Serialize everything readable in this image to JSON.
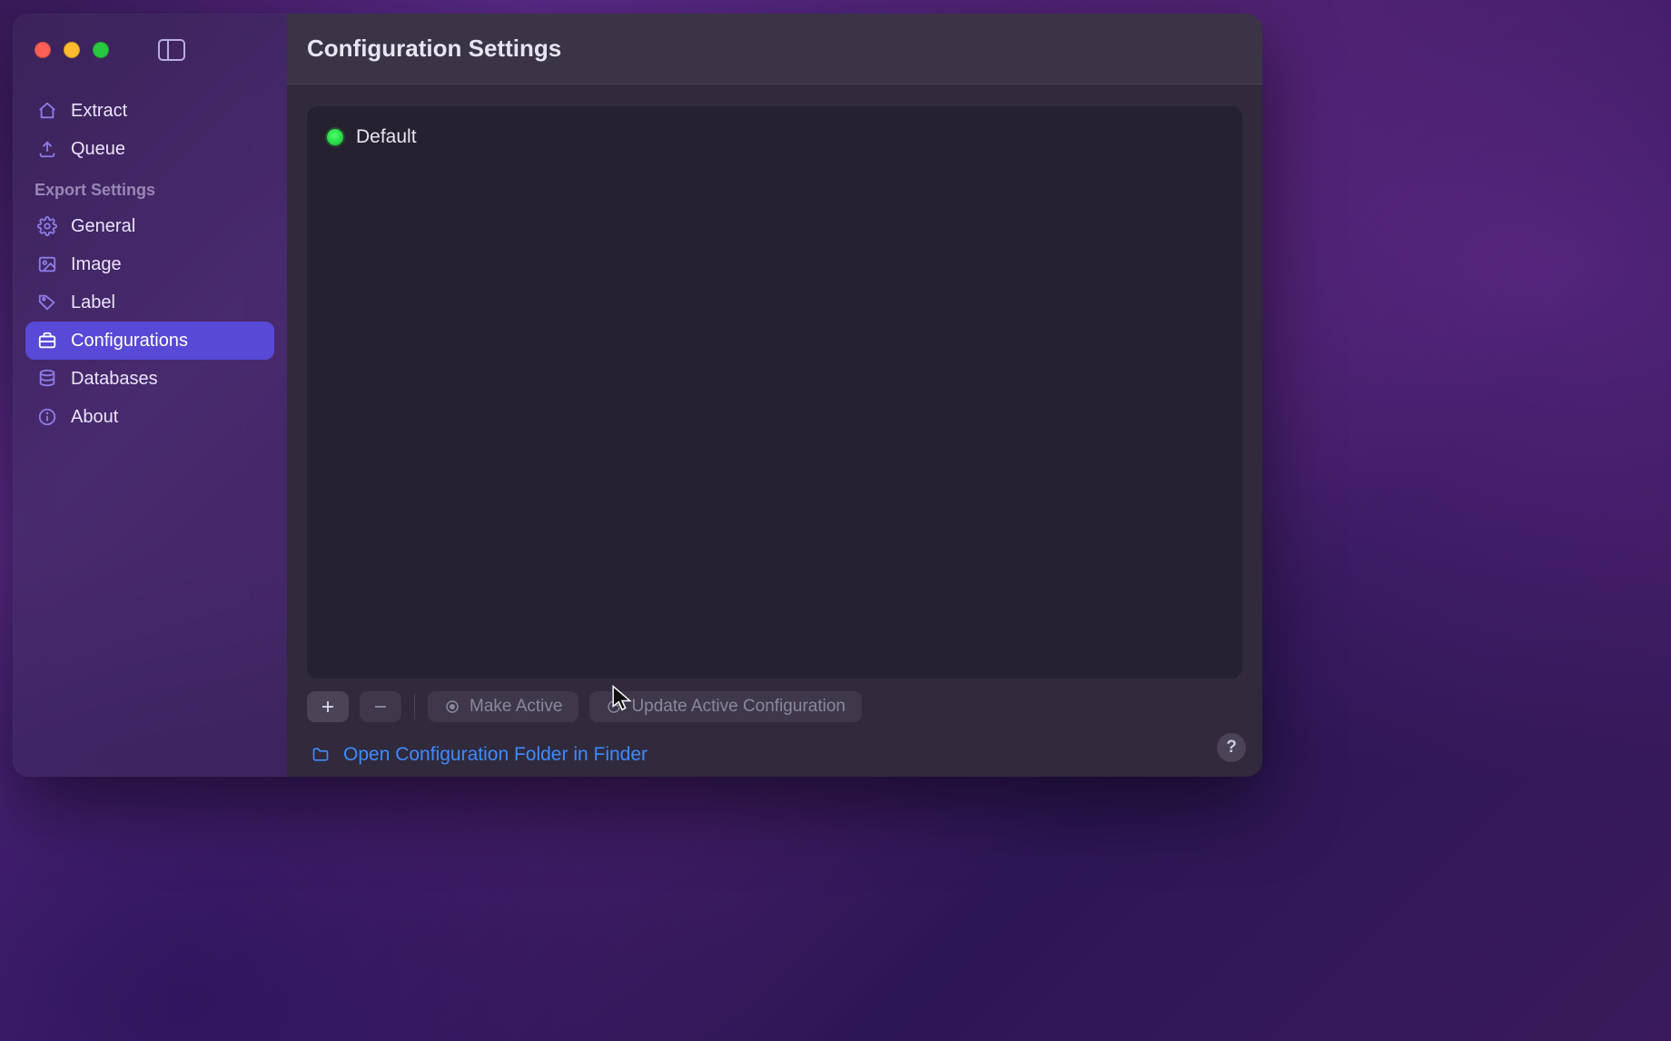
{
  "header": {
    "title": "Configuration Settings"
  },
  "sidebar": {
    "top_items": [
      {
        "label": "Extract",
        "icon": "home"
      },
      {
        "label": "Queue",
        "icon": "upload"
      }
    ],
    "section_label": "Export Settings",
    "settings_items": [
      {
        "label": "General",
        "icon": "gear",
        "selected": false
      },
      {
        "label": "Image",
        "icon": "image",
        "selected": false
      },
      {
        "label": "Label",
        "icon": "tag",
        "selected": false
      },
      {
        "label": "Configurations",
        "icon": "briefcase",
        "selected": true
      },
      {
        "label": "Databases",
        "icon": "database",
        "selected": false
      },
      {
        "label": "About",
        "icon": "info",
        "selected": false
      }
    ]
  },
  "configurations": {
    "items": [
      {
        "name": "Default",
        "active": true
      }
    ]
  },
  "toolbar": {
    "add_label": "+",
    "remove_label": "−",
    "make_active_label": "Make Active",
    "update_label": "Update Active Configuration"
  },
  "footer": {
    "open_folder_label": "Open Configuration Folder in Finder"
  },
  "help": {
    "label": "?"
  },
  "colors": {
    "accent": "#5849d6",
    "link": "#3e8bff",
    "active_green": "#28c840"
  }
}
